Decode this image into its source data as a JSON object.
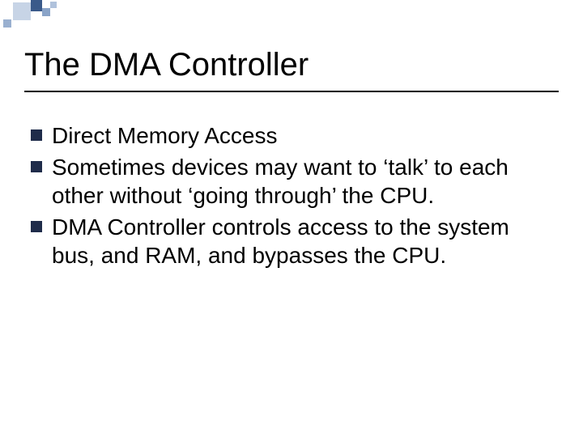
{
  "title": "The DMA Controller",
  "bullets": {
    "b0": "Direct Memory Access",
    "b1": "Sometimes devices may want to ‘talk’ to each other without ‘going through’ the CPU.",
    "b2": "DMA Controller controls access to the system bus, and RAM, and bypasses the CPU."
  }
}
